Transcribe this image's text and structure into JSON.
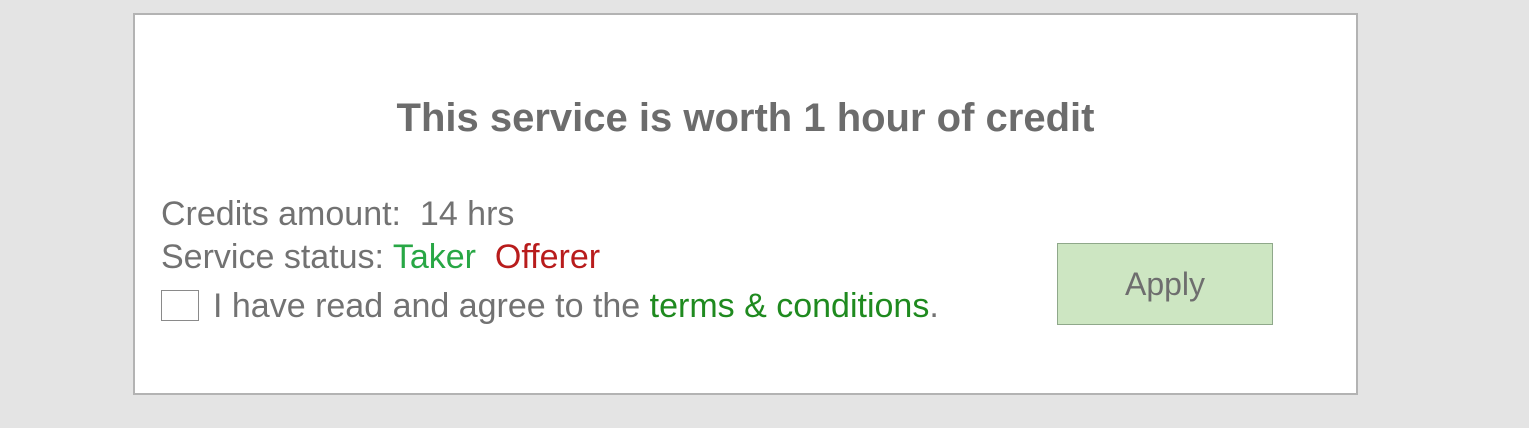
{
  "dialog": {
    "title": "This service is worth 1 hour of credit",
    "credits": {
      "label": "Credits amount:",
      "value": "14 hrs"
    },
    "status": {
      "label": "Service status:",
      "taker": "Taker",
      "offerer": "Offerer",
      "taker_color": "#28a745",
      "offerer_color": "#b81c1c"
    },
    "terms": {
      "checked": false,
      "prefix": "I have read and agree to the",
      "link": "terms & conditions",
      "suffix": "."
    },
    "apply_label": "Apply",
    "apply_color": "#cde6c2"
  }
}
